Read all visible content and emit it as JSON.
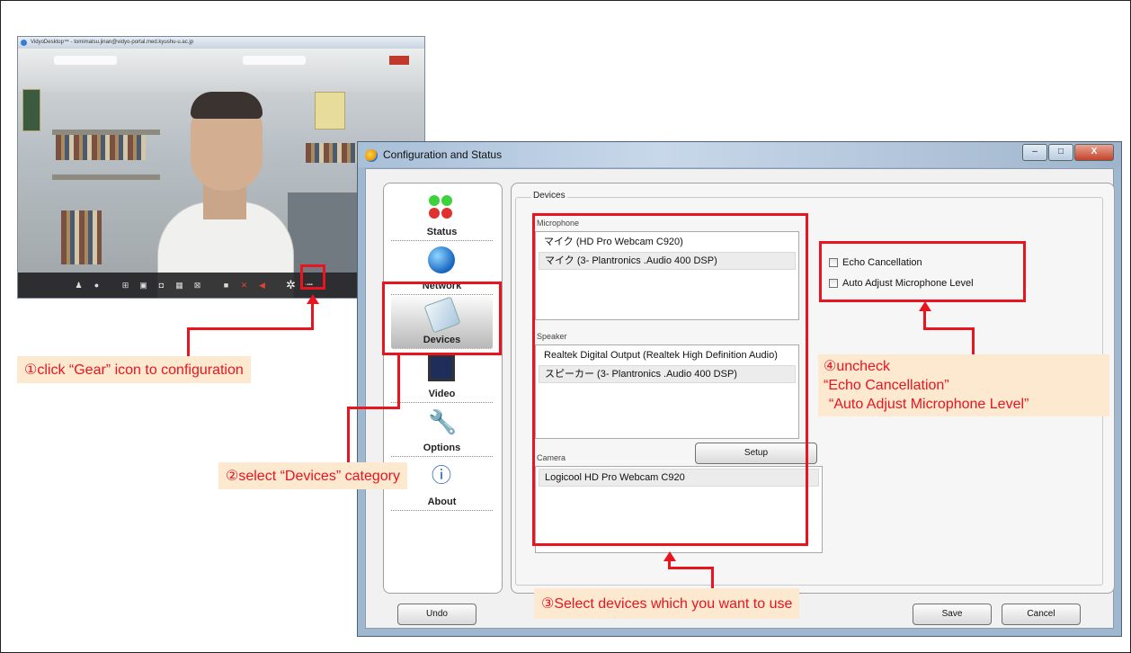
{
  "video_window": {
    "title": "VidyoDesktop™ - tomimatsu.jinan@vidyo-portal.med.kyushu-u.ac.jp",
    "toolbar_icons": [
      "contacts-icon",
      "chat-icon",
      "layout-icon",
      "self-view-icon",
      "share-icon",
      "fullscreen-icon",
      "pip-icon",
      "camera-icon",
      "mic-muted-icon",
      "speaker-muted-icon",
      "gear-icon",
      "signal-icon"
    ]
  },
  "config_dialog": {
    "title": "Configuration and Status",
    "window_buttons": {
      "minimize": "–",
      "maximize": "□",
      "close": "X"
    },
    "categories": [
      {
        "id": "status",
        "label": "Status"
      },
      {
        "id": "network",
        "label": "Network"
      },
      {
        "id": "devices",
        "label": "Devices",
        "selected": true
      },
      {
        "id": "video",
        "label": "Video"
      },
      {
        "id": "options",
        "label": "Options"
      },
      {
        "id": "about",
        "label": "About"
      }
    ],
    "devices": {
      "group_label": "Devices",
      "microphone": {
        "label": "Microphone",
        "items": [
          "マイク (HD Pro Webcam C920)",
          "マイク (3- Plantronics .Audio 400 DSP)"
        ],
        "selected_index": 1
      },
      "speaker": {
        "label": "Speaker",
        "items": [
          "Realtek Digital Output (Realtek High Definition Audio)",
          "スピーカー (3- Plantronics .Audio 400 DSP)"
        ],
        "selected_index": 1
      },
      "camera": {
        "label": "Camera",
        "items": [
          "Logicool HD Pro Webcam C920"
        ],
        "selected_index": 0,
        "setup_label": "Setup"
      },
      "echo_cancellation": {
        "label": "Echo Cancellation",
        "checked": false
      },
      "auto_adjust_mic": {
        "label": "Auto Adjust Microphone Level",
        "checked": false
      }
    },
    "buttons": {
      "undo": "Undo",
      "save": "Save",
      "cancel": "Cancel"
    }
  },
  "annotations": {
    "step1": "①click “Gear” icon to configuration",
    "step2": "②select “Devices” category",
    "step3": "③Select devices which you want to use",
    "step4_line1": "④uncheck",
    "step4_line2": "“Echo Cancellation”",
    "step4_line3": "“Auto Adjust Microphone Level”",
    "color": "#e8141f",
    "callout_bg": "#fde9cf"
  }
}
